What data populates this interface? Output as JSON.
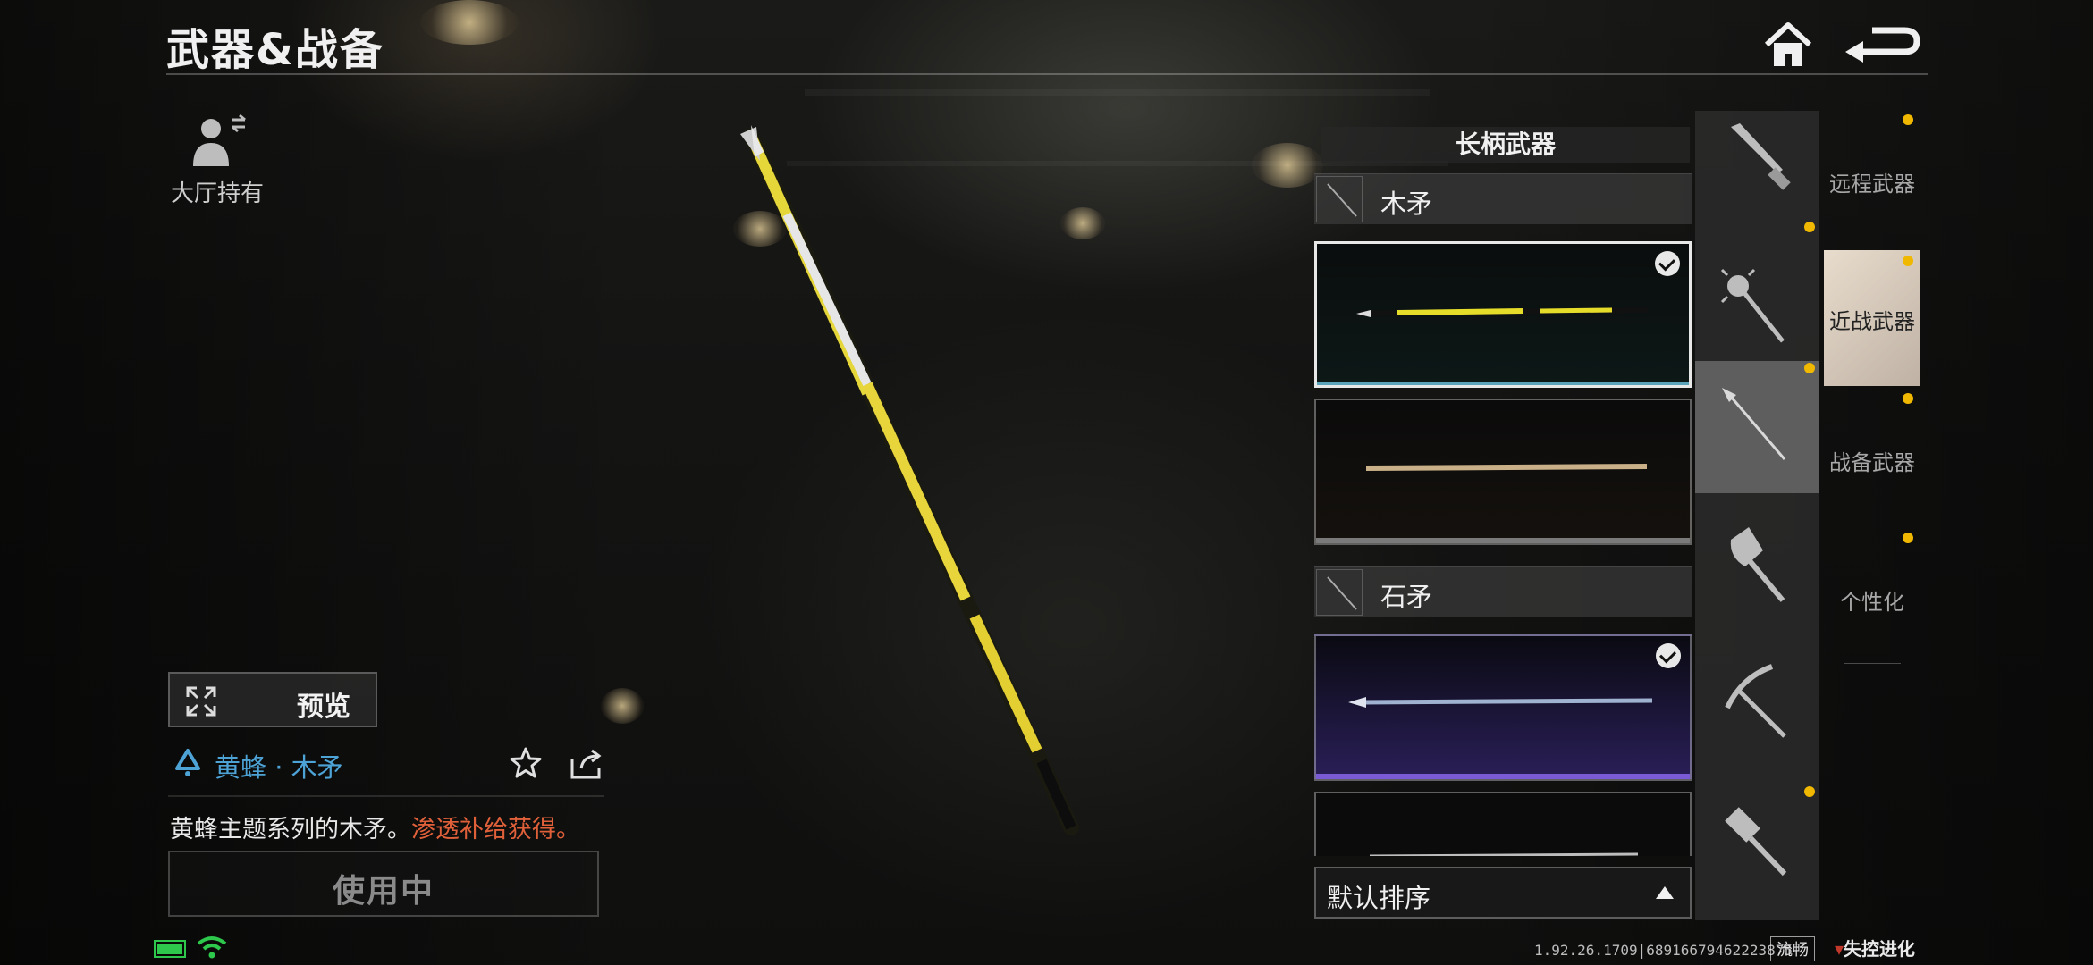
{
  "header": {
    "title": "武器&战备"
  },
  "lobby": {
    "label": "大厅持有"
  },
  "preview": {
    "label": "预览"
  },
  "item": {
    "name": "黄蜂 · 木矛",
    "desc_main": "黄蜂主题系列的木矛。",
    "desc_highlight": "渗透补给获得。",
    "use_label": "使用中"
  },
  "panel": {
    "header": "长柄武器",
    "groups": [
      {
        "name": "木矛"
      },
      {
        "name": "石矛"
      }
    ],
    "sort_label": "默认排序"
  },
  "type_icons": [
    "knife-icon",
    "mace-icon",
    "spear-icon",
    "axe-icon",
    "pickaxe-icon",
    "hammer-icon"
  ],
  "categories": [
    {
      "label": "远程武器"
    },
    {
      "label": "近战武器"
    },
    {
      "label": "战备武器"
    },
    {
      "label": "个性化"
    }
  ],
  "footer": {
    "version": "1.92.26.1709|68916679462223875",
    "quality": "流畅",
    "logo": "失控进化"
  },
  "colors": {
    "accent_dot": "#f0b800",
    "item_name": "#4ea3d6",
    "highlight": "#e0603a"
  }
}
